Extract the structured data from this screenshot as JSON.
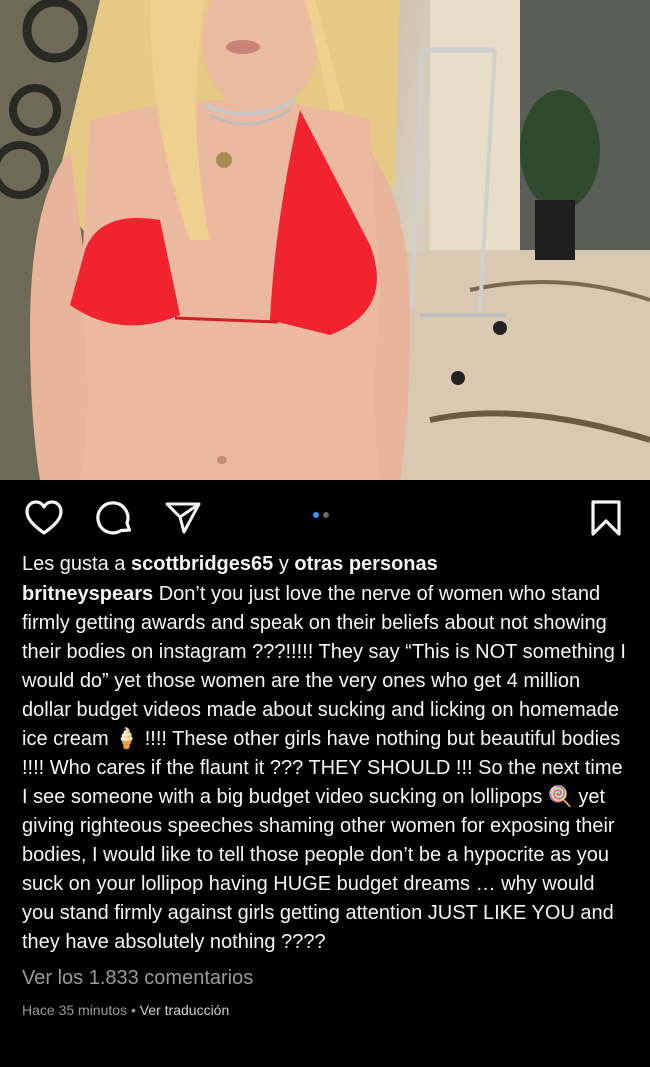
{
  "post_image": {
    "colors": {
      "skin": "#e8b49b",
      "hair": "#e6c985",
      "bikini": "#f0232f",
      "floor": "#d9c9b3"
    }
  },
  "actions": {
    "like_icon": "heart-icon",
    "comment_icon": "comment-icon",
    "share_icon": "send-icon",
    "save_icon": "bookmark-icon",
    "carousel_current": 1,
    "carousel_total": 2,
    "accent": "#3897f0"
  },
  "likes": {
    "prefix": "Les gusta a",
    "user": "scottbridges65",
    "middle": "y",
    "others": "otras personas"
  },
  "caption": {
    "username": "britneyspears",
    "part1": "Don’t you just love the nerve of women who stand firmly getting awards and speak on their beliefs about not showing their bodies on instagram ???!!!!! They say “This is NOT something I would do” yet those women are the very ones who get 4 million dollar budget videos made about sucking and licking on homemade ice cream",
    "emoji1": "🍦",
    "part2": "!!!! These other girls have nothing but beautiful bodies !!!! Who cares if the flaunt it ??? THEY SHOULD !!! So the next time I see someone with a big budget video sucking on lollipops",
    "emoji2": "🍭",
    "part3": "yet giving righteous speeches shaming other women for exposing their bodies, I would like to tell those people don’t be a hypocrite as you suck on your lollipop having HUGE budget dreams … why would you stand firmly against girls getting attention JUST LIKE YOU and they have absolutely nothing ????"
  },
  "comments_link": "Ver los 1.833 comentarios",
  "meta": {
    "time": "Hace 35 minutos",
    "separator": "•",
    "translate": "Ver traducción"
  }
}
